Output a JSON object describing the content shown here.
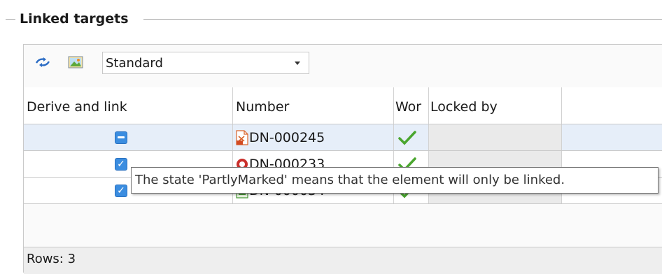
{
  "group": {
    "title": "Linked targets"
  },
  "toolbar": {
    "refresh_icon": "refresh-icon",
    "image_icon": "image-icon",
    "view_select": {
      "selected": "Standard"
    }
  },
  "grid": {
    "columns": [
      {
        "label": "Derive and link"
      },
      {
        "label": "Number"
      },
      {
        "label": "Wor"
      },
      {
        "label": "Locked by"
      },
      {
        "label": ""
      }
    ],
    "rows": [
      {
        "state": "PartlyMarked",
        "number": "DN-000245",
        "doc_icon": "pdf-file-icon",
        "work": "check",
        "locked_by": ""
      },
      {
        "state": "Checked",
        "number": "DN-000233",
        "doc_icon": "red-document-icon",
        "work": "check",
        "locked_by": ""
      },
      {
        "state": "Checked",
        "number": "DN-000034",
        "doc_icon": "green-document-icon",
        "work": "check",
        "locked_by": ""
      }
    ]
  },
  "tooltip": {
    "text": "The state 'PartlyMarked' means that the element will only be linked."
  },
  "footer": {
    "rows_label": "Rows: 3"
  },
  "colors": {
    "selection": "#e6eef9",
    "checkbox": "#3b8de0",
    "check": "#4aa62f",
    "border": "#c9c9c9"
  }
}
